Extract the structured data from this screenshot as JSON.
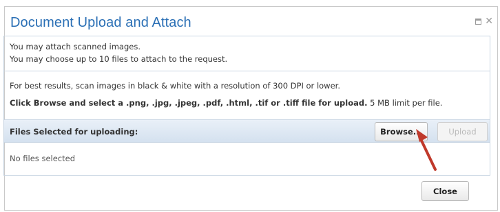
{
  "dialog": {
    "title": "Document Upload and Attach",
    "controls": {
      "maximize_icon": "maximize-icon",
      "close_icon": "close-icon",
      "close_glyph": "✕"
    }
  },
  "info": {
    "line1": "You may attach scanned images.",
    "line2": "You may choose up to 10 files to attach to the request.",
    "line3": "For best results, scan images in black & white with a resolution of 300 DPI or lower.",
    "line4_bold": "Click Browse and select a .png, .jpg, .jpeg, .pdf, .html, .tif or .tiff file for upload.",
    "line4_rest": " 5 MB limit per file."
  },
  "files": {
    "header_label": "Files Selected for uploading:",
    "browse_label": "Browse...",
    "upload_label": "Upload",
    "empty_text": "No files selected"
  },
  "footer": {
    "close_label": "Close"
  },
  "colors": {
    "title": "#2a6fb5",
    "border": "#c7d4e2",
    "header_bg": "#dce7f3",
    "arrow": "#c0392b"
  }
}
